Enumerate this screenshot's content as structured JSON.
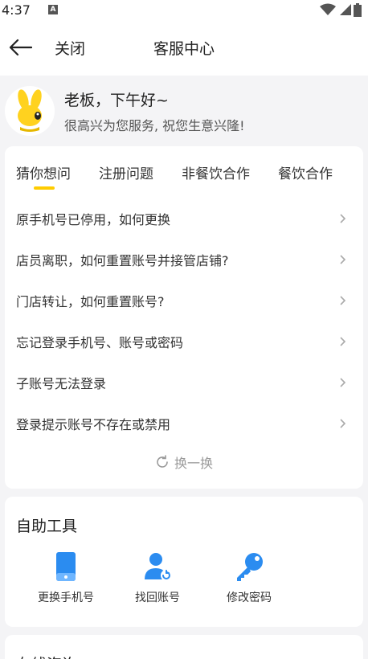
{
  "status": {
    "time": "4:37",
    "notif_letter": "A"
  },
  "nav": {
    "close_label": "关闭",
    "title": "客服中心"
  },
  "greeting": {
    "title": "老板，下午好~",
    "subtitle": "很高兴为您服务, 祝您生意兴隆!"
  },
  "tabs": [
    {
      "label": "猜你想问",
      "active": true
    },
    {
      "label": "注册问题",
      "active": false
    },
    {
      "label": "非餐饮合作",
      "active": false
    },
    {
      "label": "餐饮合作",
      "active": false
    }
  ],
  "faq": [
    "原手机号已停用，如何更换",
    "店员离职，如何重置账号并接管店铺?",
    "门店转让，如何重置账号?",
    "忘记登录手机号、账号或密码",
    "子账号无法登录",
    "登录提示账号不存在或禁用"
  ],
  "refresh_label": "换一换",
  "tools": {
    "title": "自助工具",
    "items": [
      {
        "label": "更换手机号",
        "icon": "phone-icon"
      },
      {
        "label": "找回账号",
        "icon": "user-recover-icon"
      },
      {
        "label": "修改密码",
        "icon": "key-icon"
      }
    ]
  },
  "online": {
    "title": "在线咨询"
  },
  "colors": {
    "accent": "#ffcc00",
    "icon_blue": "#2b8cf0",
    "bg": "#f4f4f6"
  }
}
